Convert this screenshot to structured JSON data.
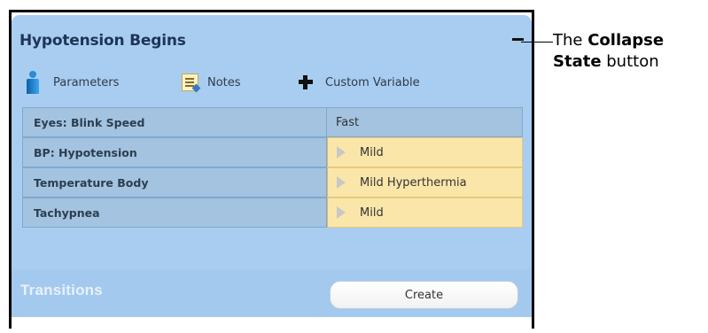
{
  "state": {
    "title": "Hypotension Begins",
    "collapse_icon": "minus-icon"
  },
  "toolbar": {
    "parameters_label": "Parameters",
    "parameters_icon": "person-icon",
    "notes_label": "Notes",
    "notes_icon": "notepad-icon",
    "custom_variable_label": "Custom Variable",
    "custom_variable_icon": "plus-icon"
  },
  "rows": [
    {
      "name": "Eyes: Blink Speed",
      "value": "Fast",
      "style": "plain"
    },
    {
      "name": "BP: Hypotension",
      "value": "Mild",
      "style": "yellow"
    },
    {
      "name": "Temperature Body",
      "value": "Mild Hyperthermia",
      "style": "yellow"
    },
    {
      "name": "Tachypnea",
      "value": "Mild",
      "style": "yellow"
    }
  ],
  "transitions": {
    "label": "Transitions",
    "create_label": "Create"
  },
  "callout": {
    "prefix": "The ",
    "bold1": "Collapse",
    "bold2": "State",
    "suffix": " button"
  },
  "colors": {
    "panel": "#a9cdf0",
    "row_name_bg": "#a3c3e0",
    "row_value_highlight": "#fbe6aa",
    "title_text": "#1d3557"
  }
}
